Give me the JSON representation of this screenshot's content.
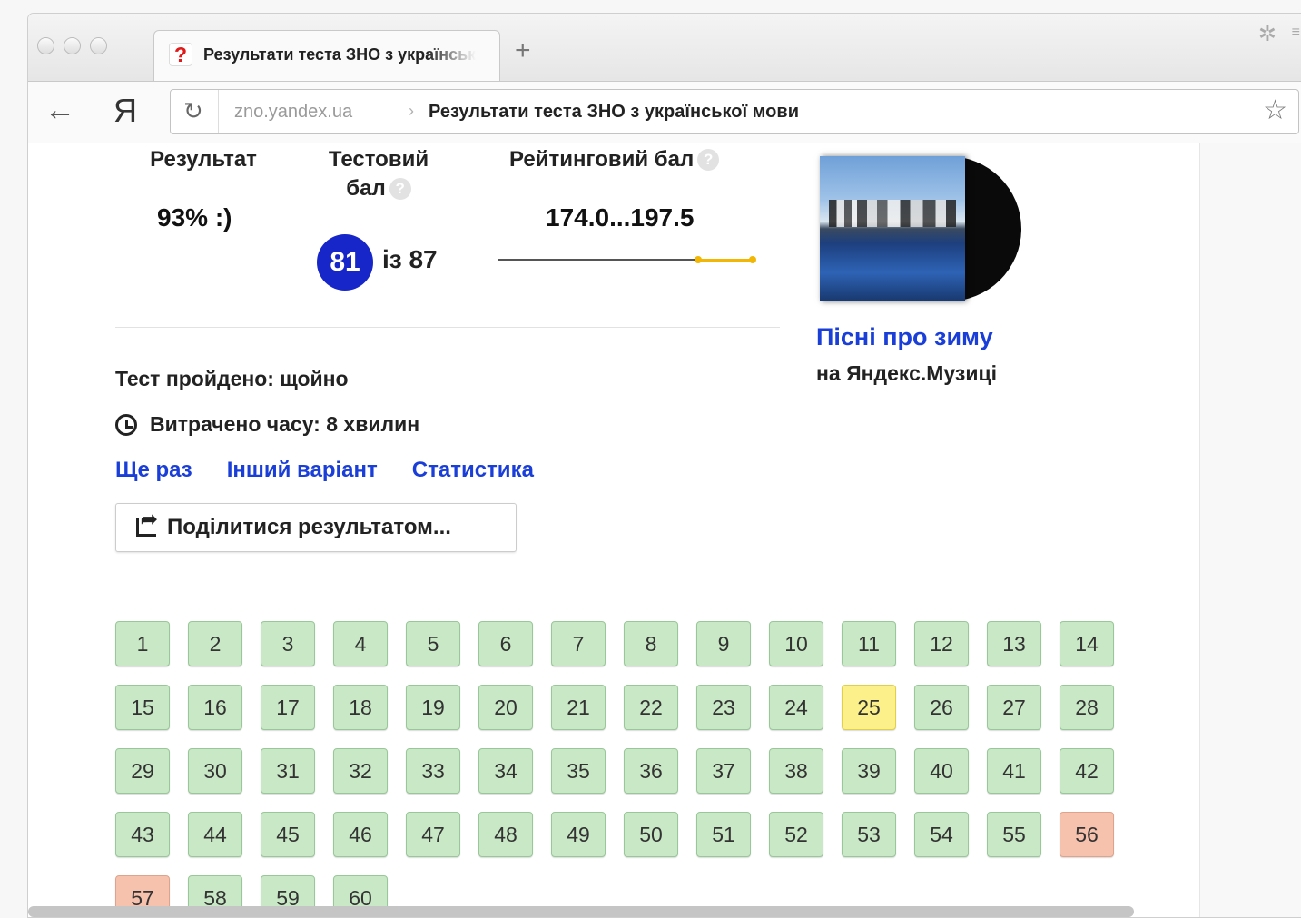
{
  "tab": {
    "favicon": "?",
    "title": "Результати теста ЗНО з української мови",
    "new_tab": "+"
  },
  "toolbar": {
    "back_icon": "←",
    "logo": "Я",
    "reload_icon": "↻",
    "url_domain": "zno.yandex.ua",
    "url_separator": "›",
    "url_title": "Результати теста ЗНО з української мови",
    "star_icon": "☆"
  },
  "stats": {
    "result_label": "Результат",
    "result_value": "93% :)",
    "test_label_line1": "Тестовий",
    "test_label_line2": "бал",
    "test_score": "81",
    "test_of": "із 87",
    "rating_label": "Рейтинговий бал",
    "rating_value": "174.0...197.5",
    "help": "?"
  },
  "info": {
    "passed": "Тест пройдено: щойно",
    "time_spent": "Витрачено часу: 8 хвилин"
  },
  "links": [
    "Ще раз",
    "Інший варіант",
    "Статистика"
  ],
  "share_button": "Поділитися результатом...",
  "promo": {
    "link": "Пісні про зиму",
    "sub": "на Яндекс.Музиці"
  },
  "questions": [
    {
      "n": "1",
      "s": "correct"
    },
    {
      "n": "2",
      "s": "correct"
    },
    {
      "n": "3",
      "s": "correct"
    },
    {
      "n": "4",
      "s": "correct"
    },
    {
      "n": "5",
      "s": "correct"
    },
    {
      "n": "6",
      "s": "correct"
    },
    {
      "n": "7",
      "s": "correct"
    },
    {
      "n": "8",
      "s": "correct"
    },
    {
      "n": "9",
      "s": "correct"
    },
    {
      "n": "10",
      "s": "correct"
    },
    {
      "n": "11",
      "s": "correct"
    },
    {
      "n": "12",
      "s": "correct"
    },
    {
      "n": "13",
      "s": "correct"
    },
    {
      "n": "14",
      "s": "correct"
    },
    {
      "n": "15",
      "s": "correct"
    },
    {
      "n": "16",
      "s": "correct"
    },
    {
      "n": "17",
      "s": "correct"
    },
    {
      "n": "18",
      "s": "correct"
    },
    {
      "n": "19",
      "s": "correct"
    },
    {
      "n": "20",
      "s": "correct"
    },
    {
      "n": "21",
      "s": "correct"
    },
    {
      "n": "22",
      "s": "correct"
    },
    {
      "n": "23",
      "s": "correct"
    },
    {
      "n": "24",
      "s": "correct"
    },
    {
      "n": "25",
      "s": "partial"
    },
    {
      "n": "26",
      "s": "correct"
    },
    {
      "n": "27",
      "s": "correct"
    },
    {
      "n": "28",
      "s": "correct"
    },
    {
      "n": "29",
      "s": "correct"
    },
    {
      "n": "30",
      "s": "correct"
    },
    {
      "n": "31",
      "s": "correct"
    },
    {
      "n": "32",
      "s": "correct"
    },
    {
      "n": "33",
      "s": "correct"
    },
    {
      "n": "34",
      "s": "correct"
    },
    {
      "n": "35",
      "s": "correct"
    },
    {
      "n": "36",
      "s": "correct"
    },
    {
      "n": "37",
      "s": "correct"
    },
    {
      "n": "38",
      "s": "correct"
    },
    {
      "n": "39",
      "s": "correct"
    },
    {
      "n": "40",
      "s": "correct"
    },
    {
      "n": "41",
      "s": "correct"
    },
    {
      "n": "42",
      "s": "correct"
    },
    {
      "n": "43",
      "s": "correct"
    },
    {
      "n": "44",
      "s": "correct"
    },
    {
      "n": "45",
      "s": "correct"
    },
    {
      "n": "46",
      "s": "correct"
    },
    {
      "n": "47",
      "s": "correct"
    },
    {
      "n": "48",
      "s": "correct"
    },
    {
      "n": "49",
      "s": "correct"
    },
    {
      "n": "50",
      "s": "correct"
    },
    {
      "n": "51",
      "s": "correct"
    },
    {
      "n": "52",
      "s": "correct"
    },
    {
      "n": "53",
      "s": "correct"
    },
    {
      "n": "54",
      "s": "correct"
    },
    {
      "n": "55",
      "s": "correct"
    },
    {
      "n": "56",
      "s": "wrong"
    },
    {
      "n": "57",
      "s": "wrong"
    },
    {
      "n": "58",
      "s": "correct"
    },
    {
      "n": "59",
      "s": "correct"
    },
    {
      "n": "60",
      "s": "correct"
    }
  ],
  "colors": {
    "link": "#1a3ed8",
    "badge": "#1626c8",
    "correct": "#c9e8c5",
    "partial": "#fbf08a",
    "wrong": "#f7c2ad",
    "rating_range": "#f2b705"
  }
}
